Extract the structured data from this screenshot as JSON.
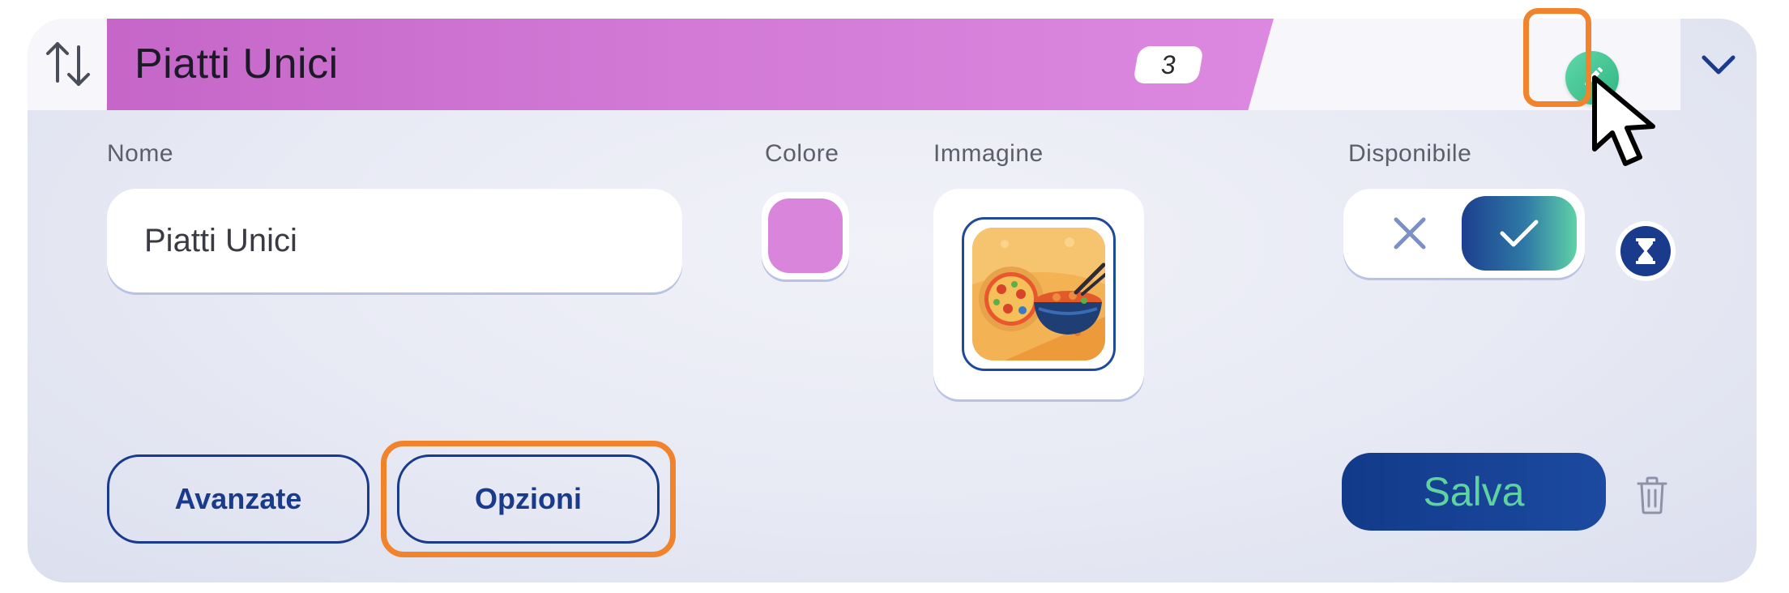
{
  "category": {
    "title": "Piatti Unici",
    "item_count": "3"
  },
  "fields": {
    "name_label": "Nome",
    "name_value": "Piatti Unici",
    "color_label": "Colore",
    "color_value": "#d985dc",
    "image_label": "Immagine",
    "available_label": "Disponibile",
    "available": true
  },
  "buttons": {
    "advanced": "Avanzate",
    "options": "Opzioni",
    "save": "Salva"
  },
  "icons": {
    "sort": "sort-arrows-icon",
    "edit": "pencil-icon",
    "collapse": "chevron-down-icon",
    "unavailable": "x-icon",
    "available": "check-icon",
    "schedule": "hourglass-icon",
    "delete": "trash-icon",
    "cursor": "mouse-pointer-icon"
  },
  "colors": {
    "title_tab": "#d27ad6",
    "accent_navy": "#1a3a8c",
    "accent_green": "#5ed3a0",
    "highlight": "#f0832b"
  }
}
